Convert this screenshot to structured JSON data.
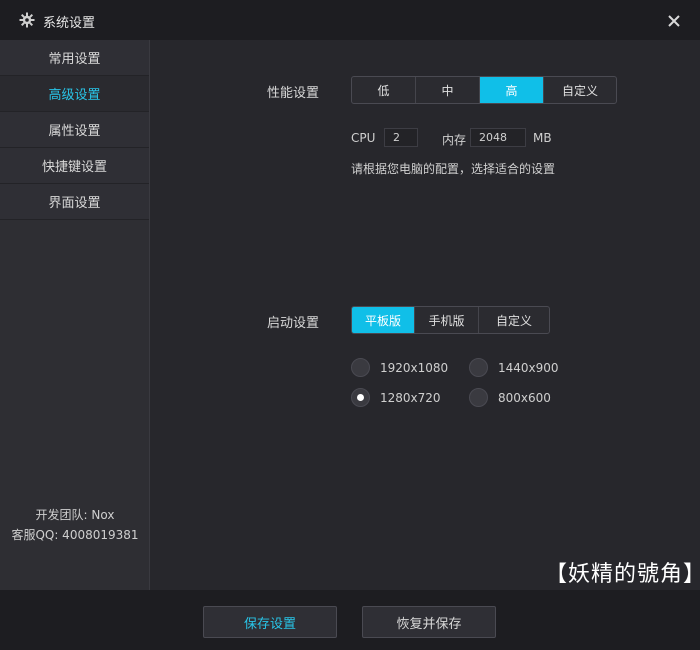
{
  "window": {
    "title": "系统设置"
  },
  "sidebar": {
    "items": [
      {
        "label": "常用设置"
      },
      {
        "label": "高级设置"
      },
      {
        "label": "属性设置"
      },
      {
        "label": "快捷键设置"
      },
      {
        "label": "界面设置"
      }
    ],
    "active_index": 1,
    "footer_team": "开发团队: Nox",
    "footer_qq": "客服QQ: 4008019381"
  },
  "performance": {
    "label": "性能设置",
    "options": [
      "低",
      "中",
      "高",
      "自定义"
    ],
    "selected": "高",
    "cpu_label": "CPU",
    "cpu_value": "2",
    "memory_label": "内存",
    "memory_value": "2048",
    "memory_unit": "MB",
    "hint": "请根据您电脑的配置，选择适合的设置"
  },
  "startup": {
    "label": "启动设置",
    "options": [
      "平板版",
      "手机版",
      "自定义"
    ],
    "selected": "平板版",
    "resolutions": [
      "1920x1080",
      "1440x900",
      "1280x720",
      "800x600"
    ],
    "selected_resolution": "1280x720"
  },
  "buttons": {
    "save": "保存设置",
    "restore": "恢复并保存"
  },
  "watermark": "【妖精的號角】",
  "colors": {
    "accent": "#10bfe8",
    "active_text": "#29c5e8",
    "background": "#27272c",
    "titlebar": "#1d1d21"
  }
}
